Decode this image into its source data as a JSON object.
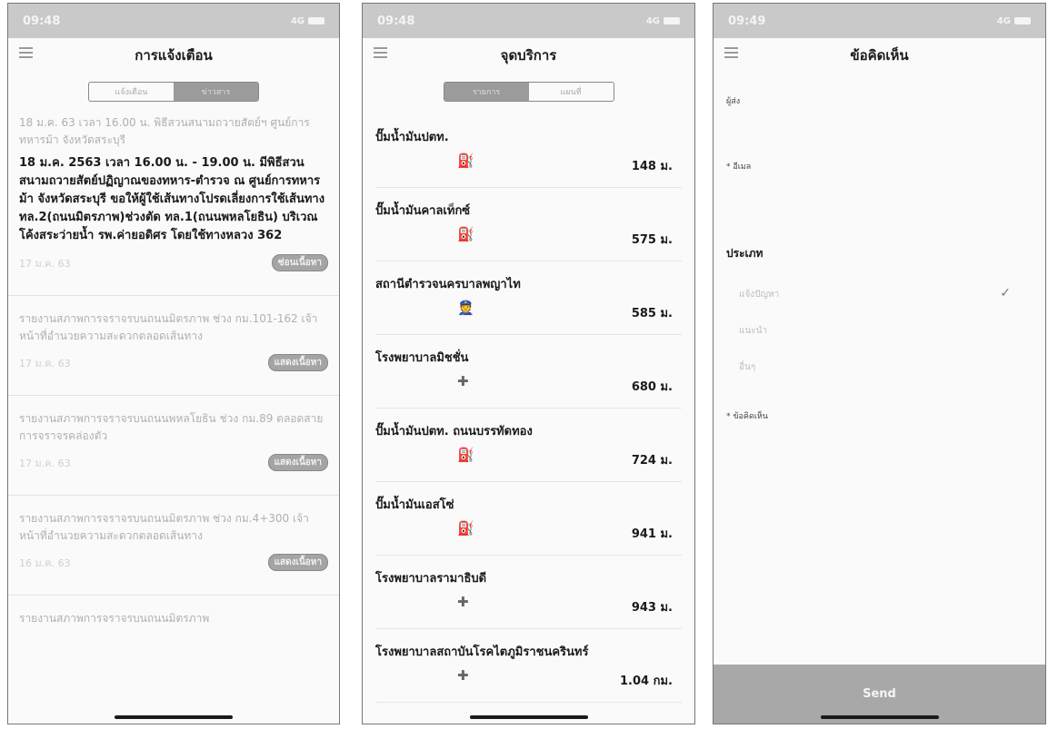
{
  "screen1": {
    "time": "09:48",
    "network": "4G",
    "title": "การแจ้งเตือน",
    "seg_left": "แจ้งเตือน",
    "seg_right": "ข่าวสาร",
    "notifications": [
      {
        "summary": "18 ม.ค. 63 เวลา 16.00 น. พิธีสวนสนามถวายสัตย์ฯ ศูนย์การทหารม้า จังหวัดสระบุรี",
        "full": "18 ม.ค. 2563 เวลา 16.00 น. - 19.00 น. มีพิธีสวนสนามถวายสัตย์ปฏิญาณของทหาร-ตำรวจ ณ ศูนย์การทหารม้า จังหวัดสระบุรี ขอให้ผู้ใช้เส้นทางโปรดเลี่ยงการใช้เส้นทางทล.2(ถนนมิตรภาพ)ช่วงตัด ทล.1(ถนนพหลโยธิน) บริเวณ โค้งสระว่ายน้ำ รพ.ค่ายอดิศร โดยใช้ทางหลวง 362",
        "date": "17 ม.ค. 63",
        "button": "ซ่อนเนื้อหา"
      },
      {
        "summary": "รายงานสภาพการจราจรบนถนนมิตรภาพ ช่วง กม.101-162 เจ้าหน้าที่อำนวยความสะดวกตลอดเส้นทาง",
        "date": "17 ม.ค. 63",
        "button": "แสดงเนื้อหา"
      },
      {
        "summary": "รายงานสภาพการจราจรบนถนนพหลโยธิน ช่วง กม.89 ตลอดสายการจราจรคล่องตัว",
        "date": "17 ม.ค. 63",
        "button": "แสดงเนื้อหา"
      },
      {
        "summary": "รายงานสภาพการจราจรบนถนนมิตรภาพ ช่วง กม.4+300 เจ้าหน้าที่อำนวยความสะดวกตลอดเส้นทาง",
        "date": "16 ม.ค. 63",
        "button": "แสดงเนื้อหา"
      },
      {
        "summary": "รายงานสภาพการจราจรบนถนนมิตรภาพ",
        "date": "",
        "button": ""
      }
    ]
  },
  "screen2": {
    "time": "09:48",
    "network": "4G",
    "title": "จุดบริการ",
    "seg_left": "รายการ",
    "seg_right": "แผนที่",
    "items": [
      {
        "name": "ปั๊มน้ำมันปตท.",
        "icon": "⛽",
        "icon_name": "fuel-icon",
        "dist": "148 ม."
      },
      {
        "name": "ปั๊มน้ำมันคาลเท็กซ์",
        "icon": "⛽",
        "icon_name": "fuel-icon",
        "dist": "575 ม."
      },
      {
        "name": "สถานีตำรวจนครบาลพญาไท",
        "icon": "👮",
        "icon_name": "police-icon",
        "dist": "585 ม."
      },
      {
        "name": "โรงพยาบาลมิชชั่น",
        "icon": "✚",
        "icon_name": "hospital-icon",
        "dist": "680 ม."
      },
      {
        "name": "ปั๊มน้ำมันปตท. ถนนบรรทัดทอง",
        "icon": "⛽",
        "icon_name": "fuel-icon",
        "dist": "724 ม."
      },
      {
        "name": "ปั๊มน้ำมันเอสโซ่",
        "icon": "⛽",
        "icon_name": "fuel-icon",
        "dist": "941 ม."
      },
      {
        "name": "โรงพยาบาลรามาธิบดี",
        "icon": "✚",
        "icon_name": "hospital-icon",
        "dist": "943 ม."
      },
      {
        "name": "โรงพยาบาลสถาบันโรคไตภูมิราชนครินทร์",
        "icon": "✚",
        "icon_name": "hospital-icon",
        "dist": "1.04 กม."
      }
    ]
  },
  "screen3": {
    "time": "09:49",
    "network": "4G",
    "title": "ข้อคิดเห็น",
    "label_sender": "ผู้ส่ง",
    "label_email": "* อีเมล",
    "label_type": "ประเภท",
    "options": [
      "แจ้งปัญหา",
      "แนะนำ",
      "อื่นๆ"
    ],
    "selected_option": 0,
    "label_comment": "* ข้อคิดเห็น",
    "send": "Send"
  }
}
